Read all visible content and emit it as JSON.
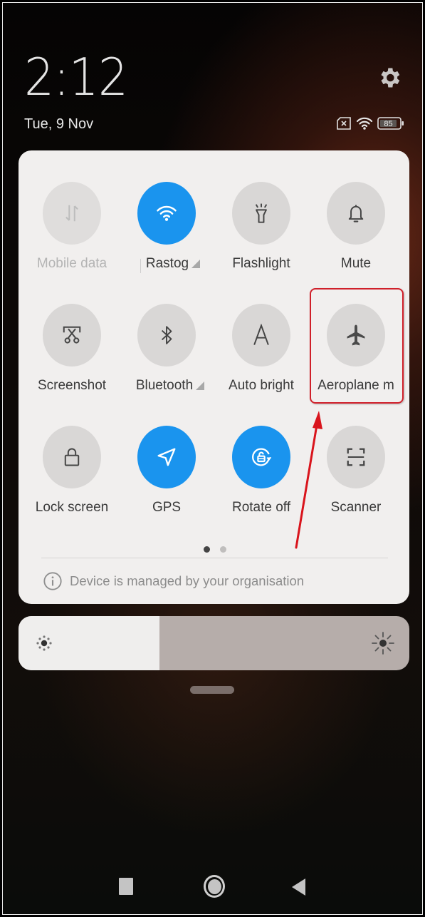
{
  "header": {
    "time": "2:12",
    "date": "Tue, 9 Nov",
    "battery_level": "85",
    "status_icons": [
      "no-sim-icon",
      "wifi-icon",
      "battery-icon"
    ],
    "settings_icon": "gear-icon"
  },
  "quick_settings": {
    "tiles": [
      {
        "label": "Mobile data",
        "icon": "mobile-data-icon",
        "state": "disabled",
        "has_detail": false
      },
      {
        "label": "Rastog",
        "icon": "wifi-icon",
        "state": "on",
        "has_detail": true
      },
      {
        "label": "Flashlight",
        "icon": "flashlight-icon",
        "state": "off",
        "has_detail": false
      },
      {
        "label": "Mute",
        "icon": "bell-icon",
        "state": "off",
        "has_detail": false
      },
      {
        "label": "Screenshot",
        "icon": "screenshot-icon",
        "state": "off",
        "has_detail": false
      },
      {
        "label": "Bluetooth",
        "icon": "bluetooth-icon",
        "state": "off",
        "has_detail": true
      },
      {
        "label": "Auto bright",
        "icon": "auto-brightness-icon",
        "state": "off",
        "has_detail": false
      },
      {
        "label": "Aeroplane m",
        "icon": "airplane-icon",
        "state": "off",
        "has_detail": false
      },
      {
        "label": "Lock screen",
        "icon": "lock-icon",
        "state": "off",
        "has_detail": false
      },
      {
        "label": "GPS",
        "icon": "location-arrow-icon",
        "state": "on",
        "has_detail": false
      },
      {
        "label": "Rotate off",
        "icon": "rotation-lock-icon",
        "state": "on",
        "has_detail": false
      },
      {
        "label": "Scanner",
        "icon": "scanner-icon",
        "state": "off",
        "has_detail": false
      }
    ],
    "page_count": 2,
    "current_page": 1,
    "managed_notice": "Device is managed by your organisation"
  },
  "brightness": {
    "level_percent": 36,
    "low_icon": "brightness-low-icon",
    "high_icon": "brightness-high-icon"
  },
  "navigation": {
    "buttons": [
      "recent-apps",
      "home",
      "back"
    ]
  },
  "annotation": {
    "highlighted_tile": "Aeroplane m",
    "color": "#d0202a"
  },
  "colors": {
    "accent": "#1a94ee",
    "tile_off": "#d9d7d6",
    "panel": "#f1efee"
  }
}
